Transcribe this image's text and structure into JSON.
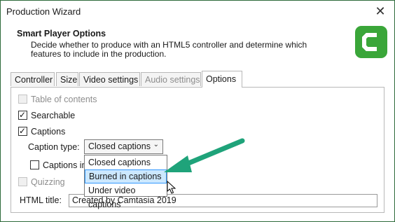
{
  "window": {
    "title": "Production Wizard"
  },
  "header": {
    "title": "Smart Player Options",
    "description": "Decide whether to produce with an HTML5 controller and determine which features to include in the production."
  },
  "tabs": [
    {
      "label": "Controller",
      "state": "normal"
    },
    {
      "label": "Size",
      "state": "normal"
    },
    {
      "label": "Video settings",
      "state": "normal"
    },
    {
      "label": "Audio settings",
      "state": "disabled"
    },
    {
      "label": "Options",
      "state": "active"
    }
  ],
  "options": {
    "table_of_contents": {
      "label": "Table of contents",
      "checked": false,
      "disabled": true
    },
    "searchable": {
      "label": "Searchable",
      "checked": true
    },
    "captions": {
      "label": "Captions",
      "checked": true
    },
    "caption_type_label": "Caption type:",
    "caption_type_value": "Closed captions",
    "captions_initially_visible": {
      "label": "Captions in",
      "checked": false
    },
    "quizzing": {
      "label": "Quizzing",
      "checked": false,
      "disabled": true
    },
    "html_title_label": "HTML title:",
    "html_title_value": "Created by Camtasia 2019"
  },
  "dropdown_list": {
    "items": [
      "Closed captions",
      "Burned in captions",
      "Under video captions"
    ],
    "highlighted": "Burned in captions"
  },
  "colors": {
    "brand_green": "#3aa639",
    "annotation_arrow": "#1fa37a",
    "selection_bg": "#cce8ff",
    "selection_border": "#3399ff"
  },
  "icons": {
    "logo": "camtasia-logo-icon",
    "close": "close-icon",
    "dropdown": "chevron-down-icon",
    "arrow": "annotation-arrow-icon",
    "cursor": "mouse-pointer-icon"
  }
}
